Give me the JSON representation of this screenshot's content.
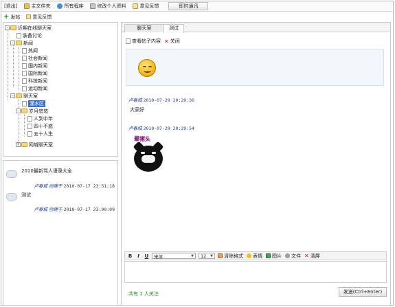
{
  "top_menu": {
    "exit": "[退出]",
    "main_folder": "主文件夹",
    "all_programs": "所有程序",
    "edit_profile": "修改个人资料",
    "feedback": "意见反馈",
    "instant_chat": "即时通讯"
  },
  "sub_menu": {
    "post": "发帖",
    "feedback": "意见反馈"
  },
  "tree": {
    "root": "近期在线聊天室",
    "n1": "装备讨论",
    "n2": "新闻",
    "n2_children": [
      "热闻",
      "社会新闻",
      "国内新闻",
      "国际新闻",
      "科技新闻",
      "运动新闻"
    ],
    "n3": "聊天室",
    "n3_children": [
      "灌水区"
    ],
    "n3_group": "岁月悠悠",
    "n3_group_children": [
      "人到中年",
      "四十不惑",
      "五十人生"
    ],
    "n3_last": "网城聊天室"
  },
  "posts": [
    {
      "title": "2010最新骂人语录大全",
      "author": "卢春城",
      "action": "创建于",
      "date": "2010-07-17 23:51:18"
    },
    {
      "title": "测试",
      "author": "卢春城",
      "action": "创建于",
      "date": "2010-07-17 23:00:09"
    }
  ],
  "tabs": [
    "聊天室",
    "测试"
  ],
  "toolbar": {
    "view_content": "查看帖子内容",
    "close": "关闭"
  },
  "messages": [
    {
      "author": "卢春城",
      "date": "2010-07-29 20:29:36",
      "text": "大家好"
    },
    {
      "author": "卢春城",
      "date": "2010-07-29 20:29:54",
      "text": ""
    }
  ],
  "sticker_caption": "晕猪头",
  "editor": {
    "bold": "B",
    "italic": "I",
    "underline": "U",
    "font": "宋体",
    "size": "12",
    "clear": "清除格式",
    "emoji": "表情",
    "image": "图片",
    "file": "文件",
    "clear_screen": "清屏"
  },
  "footer": {
    "follow_text": "共有 1 人关注",
    "send": "发送(Ctrl+Enter)"
  },
  "colors": {
    "accent": "#203d9c",
    "selected": "#3a6fd0",
    "follow": "#1e8a1e"
  }
}
